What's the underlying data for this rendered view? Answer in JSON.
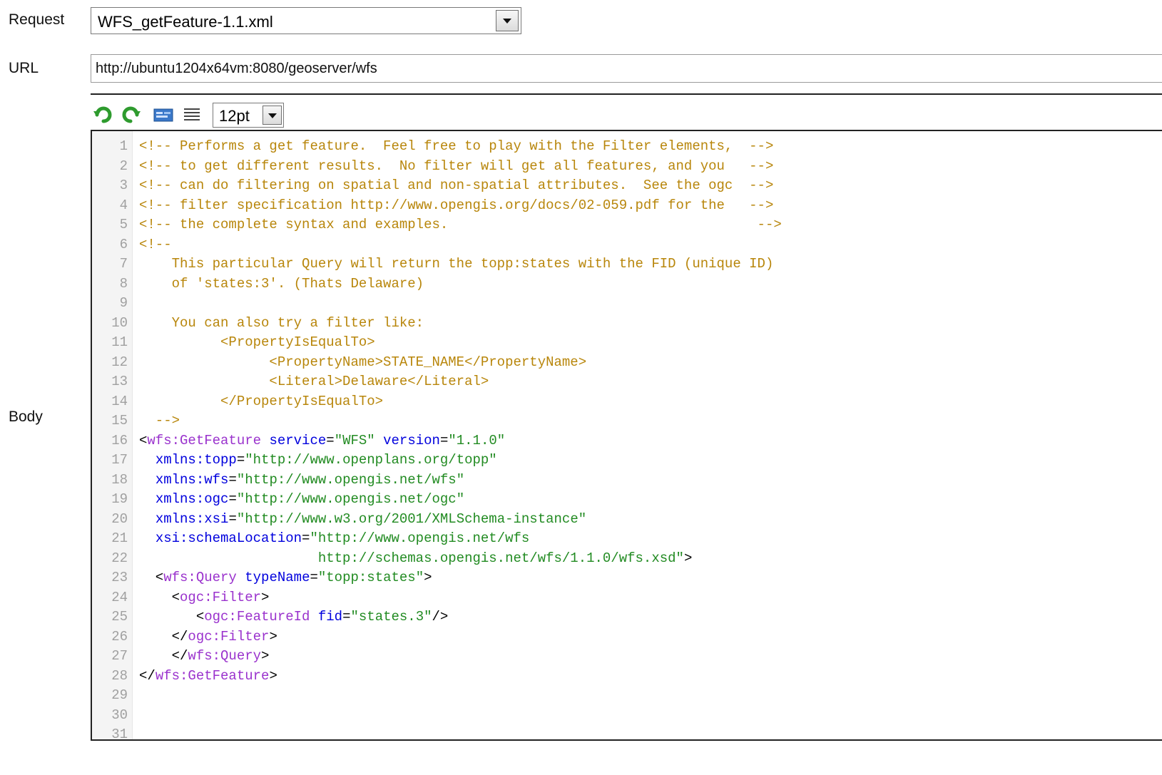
{
  "form": {
    "request_label": "Request",
    "request_value": "WFS_getFeature-1.1.xml",
    "url_label": "URL",
    "url_value": "http://ubuntu1204x64vm:8080/geoserver/wfs",
    "body_label": "Body"
  },
  "toolbar": {
    "undo_icon": "undo-icon",
    "redo_icon": "redo-icon",
    "format_icon": "format-xml-icon",
    "align_icon": "align-lines-icon",
    "font_size": "12pt"
  },
  "colors": {
    "comment": "#b8860b",
    "tag": "#9a32cd",
    "attribute": "#0000dd",
    "value": "#228b22",
    "punctuation": "#000000",
    "line_number": "#a0a0a0"
  },
  "editor": {
    "lines": [
      {
        "n": "1",
        "tokens": [
          {
            "t": "comment",
            "s": "<!-- Performs a get feature.  Feel free to play with the Filter elements,  -->"
          }
        ]
      },
      {
        "n": "2",
        "tokens": [
          {
            "t": "comment",
            "s": "<!-- to get different results.  No filter will get all features, and you   -->"
          }
        ]
      },
      {
        "n": "3",
        "tokens": [
          {
            "t": "comment",
            "s": "<!-- can do filtering on spatial and non-spatial attributes.  See the ogc  -->"
          }
        ]
      },
      {
        "n": "4",
        "tokens": [
          {
            "t": "comment",
            "s": "<!-- filter specification http://www.opengis.org/docs/02-059.pdf for the   -->"
          }
        ]
      },
      {
        "n": "5",
        "tokens": [
          {
            "t": "comment",
            "s": "<!-- the complete syntax and examples.                                      -->"
          }
        ]
      },
      {
        "n": "6",
        "tokens": [
          {
            "t": "comment",
            "s": "<!--"
          }
        ]
      },
      {
        "n": "7",
        "tokens": [
          {
            "t": "comment",
            "s": "    This particular Query will return the topp:states with the FID (unique ID)"
          }
        ]
      },
      {
        "n": "8",
        "tokens": [
          {
            "t": "comment",
            "s": "    of 'states:3'. (Thats Delaware)"
          }
        ]
      },
      {
        "n": "9",
        "tokens": []
      },
      {
        "n": "10",
        "tokens": [
          {
            "t": "comment",
            "s": "    You can also try a filter like:"
          }
        ]
      },
      {
        "n": "11",
        "tokens": [
          {
            "t": "comment",
            "s": "          <PropertyIsEqualTo>"
          }
        ]
      },
      {
        "n": "12",
        "tokens": [
          {
            "t": "comment",
            "s": "                <PropertyName>STATE_NAME</PropertyName>"
          }
        ]
      },
      {
        "n": "13",
        "tokens": [
          {
            "t": "comment",
            "s": "                <Literal>Delaware</Literal>"
          }
        ]
      },
      {
        "n": "14",
        "tokens": [
          {
            "t": "comment",
            "s": "          </PropertyIsEqualTo>"
          }
        ]
      },
      {
        "n": "15",
        "tokens": [
          {
            "t": "comment",
            "s": "  -->"
          }
        ]
      },
      {
        "n": "16",
        "tokens": [
          {
            "t": "punct",
            "s": "<"
          },
          {
            "t": "tag",
            "s": "wfs:GetFeature"
          },
          {
            "t": "punct",
            "s": " "
          },
          {
            "t": "attr",
            "s": "service"
          },
          {
            "t": "punct",
            "s": "="
          },
          {
            "t": "val",
            "s": "\"WFS\""
          },
          {
            "t": "punct",
            "s": " "
          },
          {
            "t": "attr",
            "s": "version"
          },
          {
            "t": "punct",
            "s": "="
          },
          {
            "t": "val",
            "s": "\"1.1.0\""
          }
        ]
      },
      {
        "n": "17",
        "tokens": [
          {
            "t": "punct",
            "s": "  "
          },
          {
            "t": "attr",
            "s": "xmlns:topp"
          },
          {
            "t": "punct",
            "s": "="
          },
          {
            "t": "val",
            "s": "\"http://www.openplans.org/topp\""
          }
        ]
      },
      {
        "n": "18",
        "tokens": [
          {
            "t": "punct",
            "s": "  "
          },
          {
            "t": "attr",
            "s": "xmlns:wfs"
          },
          {
            "t": "punct",
            "s": "="
          },
          {
            "t": "val",
            "s": "\"http://www.opengis.net/wfs\""
          }
        ]
      },
      {
        "n": "19",
        "tokens": [
          {
            "t": "punct",
            "s": "  "
          },
          {
            "t": "attr",
            "s": "xmlns:ogc"
          },
          {
            "t": "punct",
            "s": "="
          },
          {
            "t": "val",
            "s": "\"http://www.opengis.net/ogc\""
          }
        ]
      },
      {
        "n": "20",
        "tokens": [
          {
            "t": "punct",
            "s": "  "
          },
          {
            "t": "attr",
            "s": "xmlns:xsi"
          },
          {
            "t": "punct",
            "s": "="
          },
          {
            "t": "val",
            "s": "\"http://www.w3.org/2001/XMLSchema-instance\""
          }
        ]
      },
      {
        "n": "21",
        "tokens": [
          {
            "t": "punct",
            "s": "  "
          },
          {
            "t": "attr",
            "s": "xsi:schemaLocation"
          },
          {
            "t": "punct",
            "s": "="
          },
          {
            "t": "val",
            "s": "\"http://www.opengis.net/wfs"
          }
        ]
      },
      {
        "n": "22",
        "tokens": [
          {
            "t": "val",
            "s": "                      http://schemas.opengis.net/wfs/1.1.0/wfs.xsd\""
          },
          {
            "t": "punct",
            "s": ">"
          }
        ]
      },
      {
        "n": "23",
        "tokens": [
          {
            "t": "punct",
            "s": "  <"
          },
          {
            "t": "tag",
            "s": "wfs:Query"
          },
          {
            "t": "punct",
            "s": " "
          },
          {
            "t": "attr",
            "s": "typeName"
          },
          {
            "t": "punct",
            "s": "="
          },
          {
            "t": "val",
            "s": "\"topp:states\""
          },
          {
            "t": "punct",
            "s": ">"
          }
        ]
      },
      {
        "n": "24",
        "tokens": [
          {
            "t": "punct",
            "s": "    <"
          },
          {
            "t": "tag",
            "s": "ogc:Filter"
          },
          {
            "t": "punct",
            "s": ">"
          }
        ]
      },
      {
        "n": "25",
        "tokens": [
          {
            "t": "punct",
            "s": "       <"
          },
          {
            "t": "tag",
            "s": "ogc:FeatureId"
          },
          {
            "t": "punct",
            "s": " "
          },
          {
            "t": "attr",
            "s": "fid"
          },
          {
            "t": "punct",
            "s": "="
          },
          {
            "t": "val",
            "s": "\"states.3\""
          },
          {
            "t": "punct",
            "s": "/>"
          }
        ]
      },
      {
        "n": "26",
        "tokens": [
          {
            "t": "punct",
            "s": "    </"
          },
          {
            "t": "tag",
            "s": "ogc:Filter"
          },
          {
            "t": "punct",
            "s": ">"
          }
        ]
      },
      {
        "n": "27",
        "tokens": [
          {
            "t": "punct",
            "s": "    </"
          },
          {
            "t": "tag",
            "s": "wfs:Query"
          },
          {
            "t": "punct",
            "s": ">"
          }
        ]
      },
      {
        "n": "28",
        "tokens": [
          {
            "t": "punct",
            "s": "</"
          },
          {
            "t": "tag",
            "s": "wfs:GetFeature"
          },
          {
            "t": "punct",
            "s": ">"
          }
        ]
      },
      {
        "n": "29",
        "tokens": []
      },
      {
        "n": "30",
        "tokens": []
      },
      {
        "n": "31",
        "tokens": []
      }
    ]
  }
}
